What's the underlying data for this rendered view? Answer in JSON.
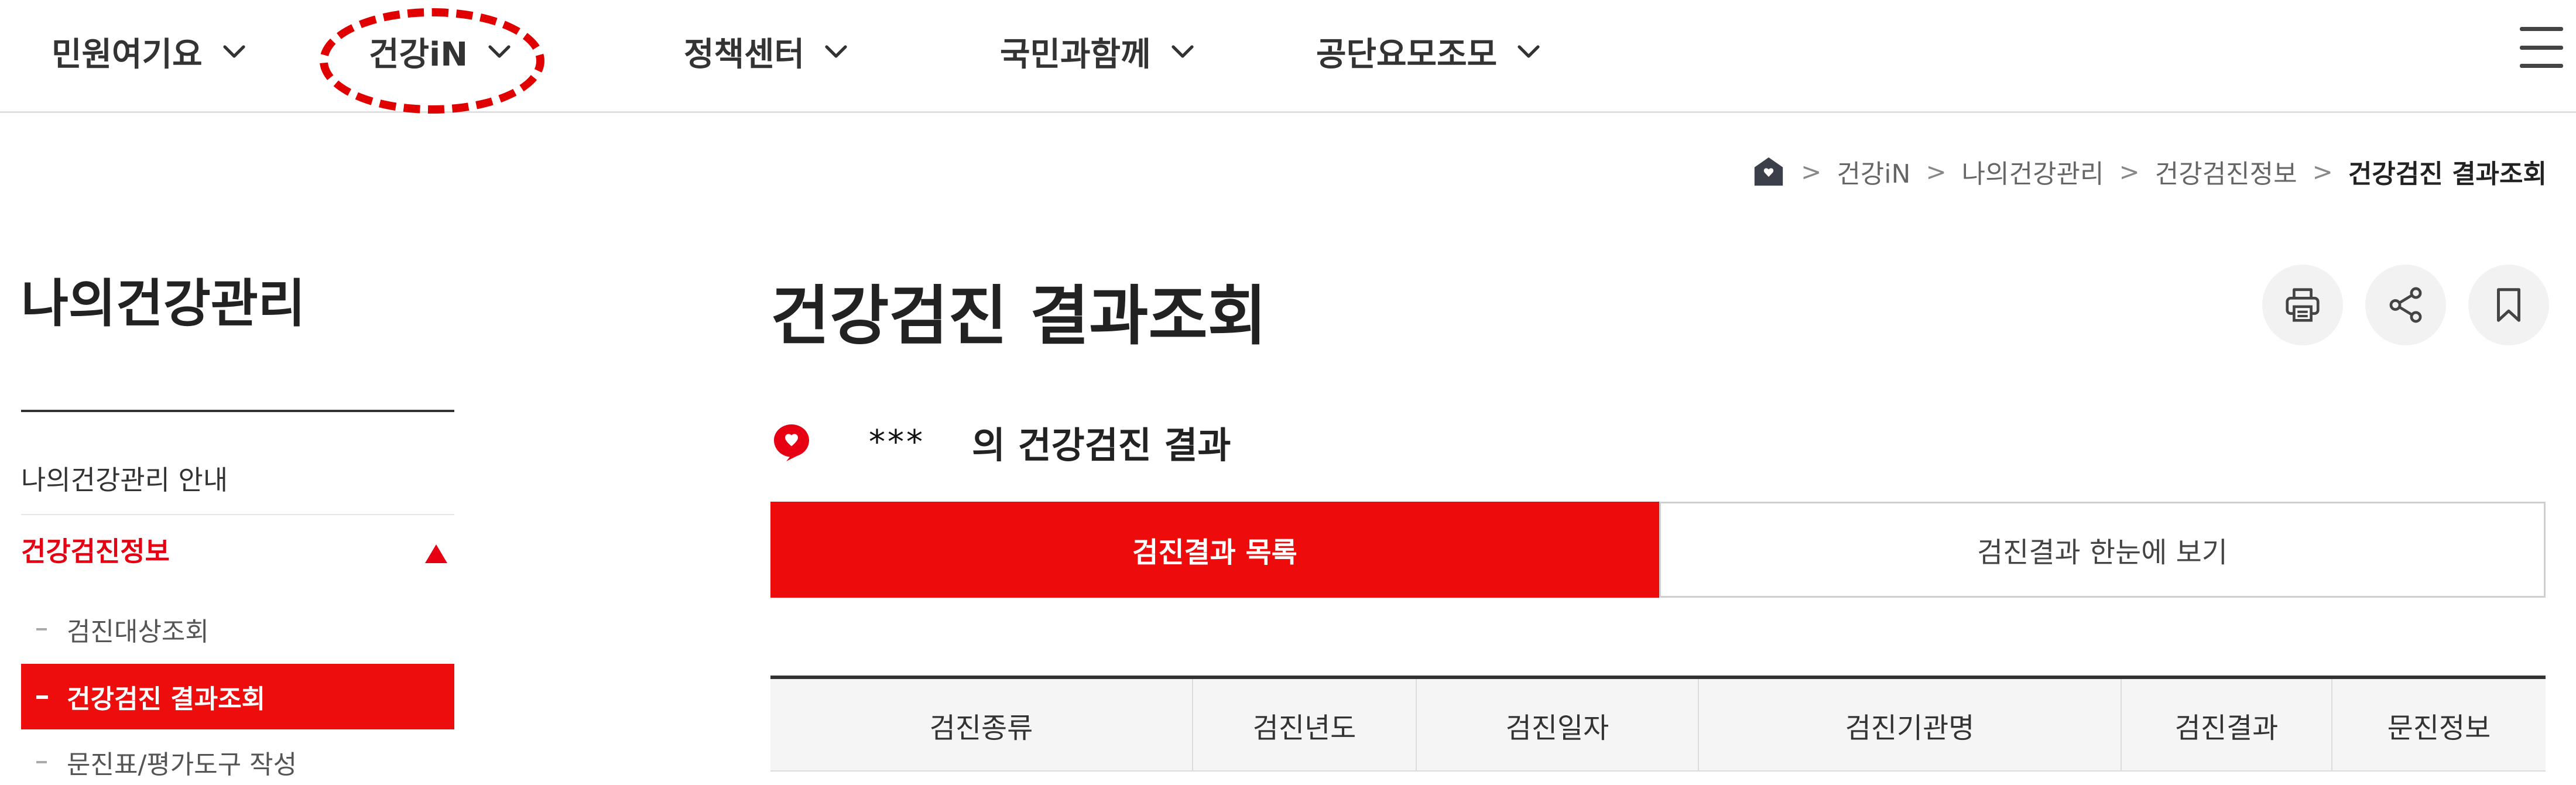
{
  "nav": {
    "items": [
      {
        "label": "민원여기요"
      },
      {
        "label": "건강iN"
      },
      {
        "label": "정책센터"
      },
      {
        "label": "국민과함께"
      },
      {
        "label": "공단요모조모"
      }
    ],
    "highlight_color": "#e00000"
  },
  "breadcrumb": {
    "items": [
      "건강iN",
      "나의건강관리",
      "건강검진정보"
    ],
    "current": "건강검진 결과조회"
  },
  "sidebar": {
    "title": "나의건강관리",
    "guide": "나의건강관리 안내",
    "section": "건강검진정보",
    "sub_items": [
      {
        "label": "검진대상조회"
      },
      {
        "label": "건강검진 결과조회",
        "active": true
      },
      {
        "label": "문진표/평가도구 작성"
      }
    ]
  },
  "main": {
    "title": "건강검진 결과조회",
    "result_owner": "***",
    "result_suffix": "의 건강검진 결과",
    "tabs": [
      {
        "label": "검진결과 목록",
        "active": true
      },
      {
        "label": "검진결과 한눈에 보기",
        "active": false
      }
    ],
    "table": {
      "headers": [
        "검진종류",
        "검진년도",
        "검진일자",
        "검진기관명",
        "검진결과",
        "문진정보"
      ]
    }
  },
  "icons": {
    "home": "home-icon",
    "print": "print-icon",
    "share": "share-icon",
    "bookmark": "bookmark-icon",
    "menu": "hamburger-icon",
    "heart": "heart-badge-icon"
  },
  "colors": {
    "accent": "#ee0b0b",
    "text": "#222222"
  }
}
